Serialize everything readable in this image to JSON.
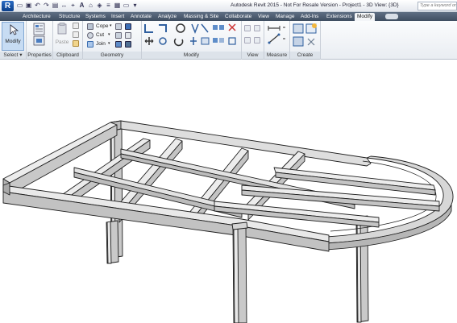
{
  "titlebar": {
    "app_letter": "R",
    "title": "Autodesk Revit 2015 - Not For Resale Version -   Project1 - 3D View: {3D}",
    "search_placeholder": "Type a keyword or p"
  },
  "tabs": [
    {
      "label": "Architecture"
    },
    {
      "label": "Structure"
    },
    {
      "label": "Systems"
    },
    {
      "label": "Insert"
    },
    {
      "label": "Annotate"
    },
    {
      "label": "Analyze"
    },
    {
      "label": "Massing & Site"
    },
    {
      "label": "Collaborate"
    },
    {
      "label": "View"
    },
    {
      "label": "Manage"
    },
    {
      "label": "Add-Ins"
    },
    {
      "label": "Extensions"
    },
    {
      "label": "Modify",
      "active": true
    }
  ],
  "ribbon": {
    "select": {
      "button": "Modify",
      "panel": "Select ▾"
    },
    "properties": {
      "panel": "Properties"
    },
    "clipboard": {
      "paste": "Paste",
      "panel": "Clipboard"
    },
    "geometry": {
      "cope": "Cope",
      "cut": "Cut",
      "join": "Join",
      "panel": "Geometry"
    },
    "modify": {
      "panel": "Modify"
    },
    "view": {
      "panel": "View"
    },
    "measure": {
      "panel": "Measure"
    },
    "create": {
      "panel": "Create"
    }
  },
  "colors": {
    "ribbon_bg": "#eef1f5",
    "tab_bar": "#4b5a6d",
    "beam_top": "#e6e6e6",
    "beam_side": "#b7b7b7",
    "outline": "#1e1e1e"
  }
}
